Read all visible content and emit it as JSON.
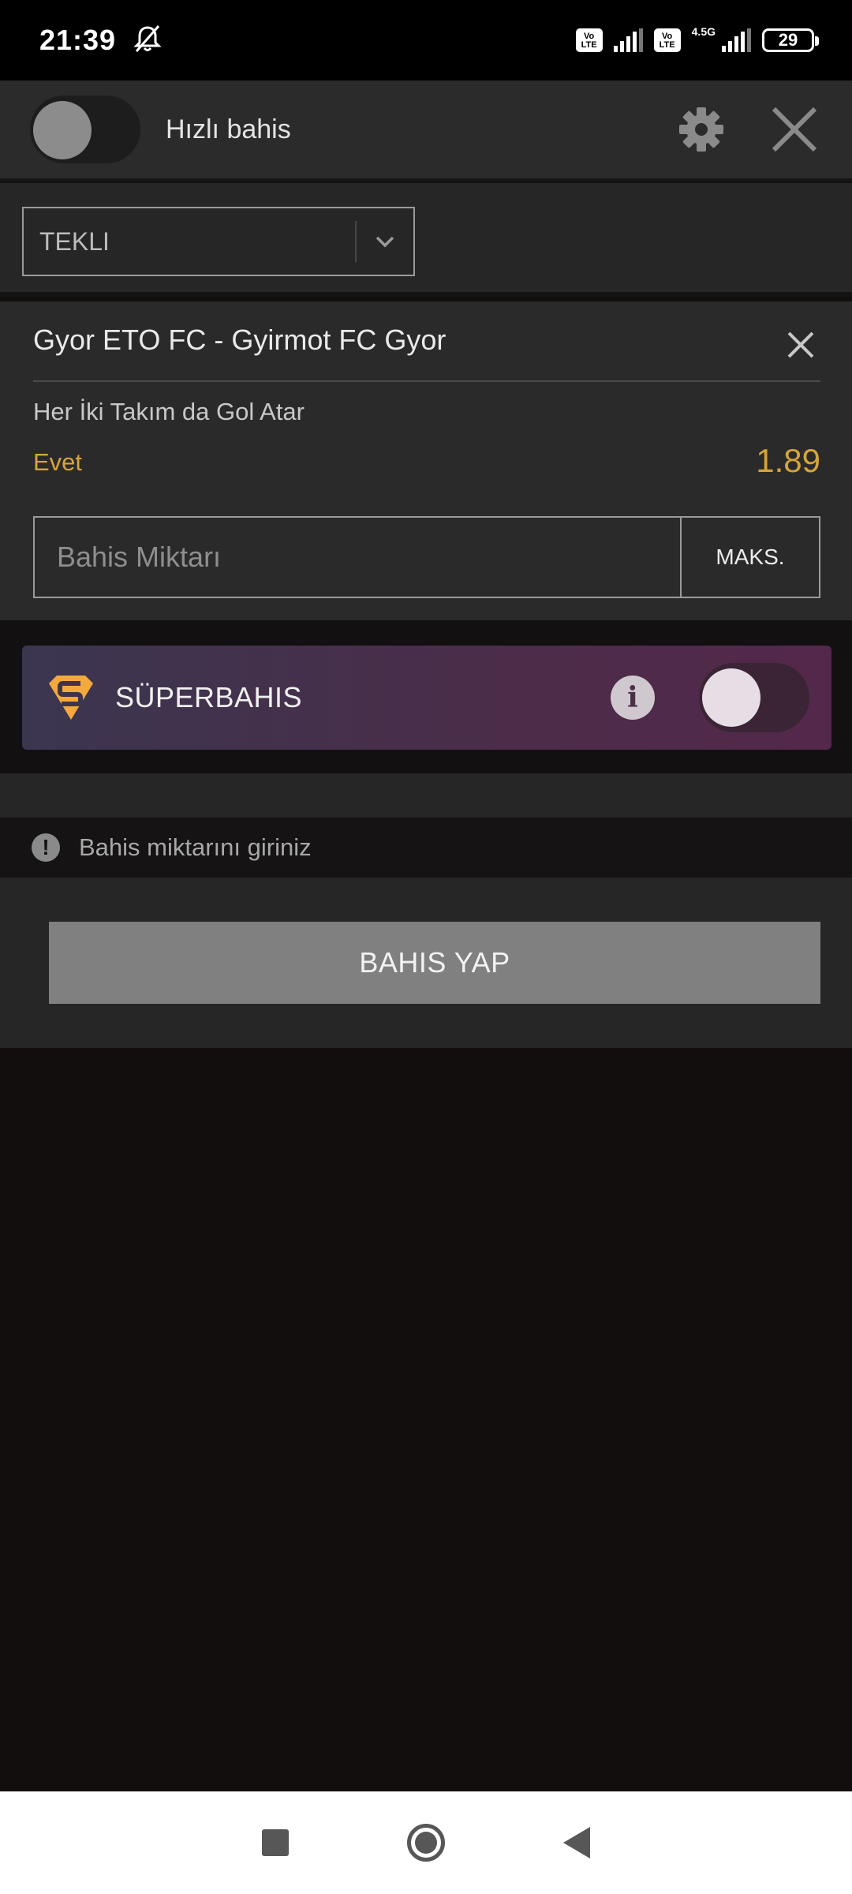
{
  "status_bar": {
    "time": "21:39",
    "volte_label": "Vo LTE",
    "network_type": "4.5G",
    "battery": "29"
  },
  "header": {
    "quick_bet_label": "Hızlı bahis",
    "quick_bet_enabled": false
  },
  "bet_type": {
    "selected": "TEKLI"
  },
  "bet": {
    "match": "Gyor ETO FC - Gyirmot FC Gyor",
    "market": "Her İki Takım da Gol Atar",
    "selection": "Evet",
    "odds": "1.89",
    "stake_placeholder": "Bahis Miktarı",
    "stake_value": "",
    "max_label": "MAKS."
  },
  "super_bet": {
    "label": "SÜPERBAHIS",
    "info_glyph": "i",
    "enabled": false
  },
  "warning": {
    "icon": "!",
    "text": "Bahis miktarını giriniz"
  },
  "place_bet": {
    "label": "BAHIS YAP"
  },
  "colors": {
    "accent_odds": "#d5a43a",
    "super_gradient_start": "#3b3650",
    "super_gradient_end": "#54284a",
    "logo_orange": "#f3a93c"
  }
}
